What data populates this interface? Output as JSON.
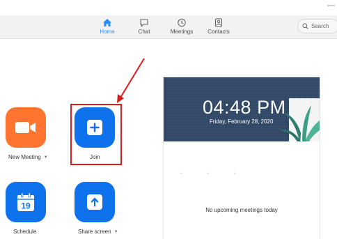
{
  "window": {
    "minimize_glyph": "—"
  },
  "tabs": [
    {
      "label": "Home",
      "icon": "home-icon",
      "active": true
    },
    {
      "label": "Chat",
      "icon": "chat-icon",
      "active": false
    },
    {
      "label": "Meetings",
      "icon": "clock-icon",
      "active": false
    },
    {
      "label": "Contacts",
      "icon": "contacts-icon",
      "active": false
    }
  ],
  "search": {
    "placeholder": "Search"
  },
  "actions": {
    "new_meeting": {
      "label": "New Meeting",
      "icon": "video-camera-icon",
      "color": "#ff742e",
      "has_dropdown": true
    },
    "join": {
      "label": "Join",
      "icon": "plus-icon",
      "color": "#0e72ed"
    },
    "schedule": {
      "label": "Schedule",
      "icon": "calendar-icon",
      "calendar_day": "19",
      "color": "#0e72ed"
    },
    "share_screen": {
      "label": "Share screen",
      "icon": "share-screen-icon",
      "color": "#0e72ed",
      "has_dropdown": true
    }
  },
  "annotation": {
    "color": "#e01b1b"
  },
  "meetings_card": {
    "time": "04:48 PM",
    "date": "Friday, February 28, 2020",
    "empty_message": "No upcoming meetings today",
    "header_color": "#314866"
  },
  "colors": {
    "accent": "#2d8cff",
    "orange": "#ff742e",
    "blue": "#0e72ed"
  }
}
